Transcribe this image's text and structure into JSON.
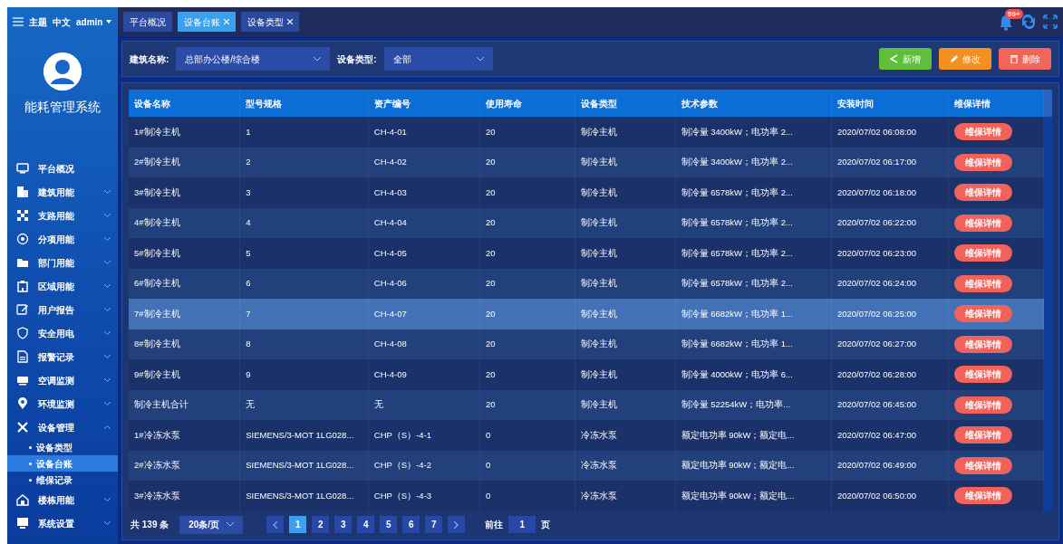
{
  "topbar": {
    "theme": "主题",
    "language": "中文",
    "user": "admin"
  },
  "tabs": [
    {
      "label": "平台概况",
      "closable": false,
      "selected": false
    },
    {
      "label": "设备台账",
      "closable": true,
      "selected": true
    },
    {
      "label": "设备类型",
      "closable": true,
      "selected": false
    }
  ],
  "notifications": {
    "badge": "99+"
  },
  "app_title": "能耗管理系统",
  "sidebar": {
    "items": [
      {
        "label": "平台概况",
        "kind": "link"
      },
      {
        "label": "建筑用能",
        "kind": "group",
        "expanded": false
      },
      {
        "label": "支路用能",
        "kind": "group",
        "expanded": false
      },
      {
        "label": "分项用能",
        "kind": "group",
        "expanded": false
      },
      {
        "label": "部门用能",
        "kind": "group",
        "expanded": false
      },
      {
        "label": "区域用能",
        "kind": "group",
        "expanded": false
      },
      {
        "label": "用户报告",
        "kind": "group",
        "expanded": false
      },
      {
        "label": "安全用电",
        "kind": "group",
        "expanded": false
      },
      {
        "label": "报警记录",
        "kind": "group",
        "expanded": false
      },
      {
        "label": "空调监测",
        "kind": "group",
        "expanded": false
      },
      {
        "label": "环境监测",
        "kind": "group",
        "expanded": false
      },
      {
        "label": "设备管理",
        "kind": "group",
        "expanded": true,
        "children": [
          {
            "label": "设备类型",
            "selected": false
          },
          {
            "label": "设备台账",
            "selected": true
          },
          {
            "label": "维保记录",
            "selected": false
          }
        ]
      },
      {
        "label": "楼栋用能",
        "kind": "group",
        "expanded": false
      },
      {
        "label": "系统设置",
        "kind": "group",
        "expanded": false
      }
    ]
  },
  "filters": [
    {
      "label": "建筑名称:",
      "value": "总部办公楼/综合楼"
    },
    {
      "label": "设备类型:",
      "value": "全部"
    }
  ],
  "actions": [
    {
      "label": "新增",
      "kind": "add"
    },
    {
      "label": "修改",
      "kind": "edit"
    },
    {
      "label": "删除",
      "kind": "delete"
    }
  ],
  "table": {
    "columns": [
      "设备名称",
      "型号规格",
      "资产编号",
      "使用寿命",
      "设备类型",
      "技术参数",
      "安装时间",
      "维保详情"
    ],
    "rows": [
      {
        "cells": [
          "1#制冷主机",
          "1",
          "CH-4-01",
          "20",
          "制冷主机",
          "制冷量 3400kW；电功率 2...",
          "2020/07/02 06:08:00"
        ],
        "action": "维保详情",
        "selected": false
      },
      {
        "cells": [
          "2#制冷主机",
          "2",
          "CH-4-02",
          "20",
          "制冷主机",
          "制冷量 3400kW；电功率 2...",
          "2020/07/02 06:17:00"
        ],
        "action": "维保详情",
        "selected": false
      },
      {
        "cells": [
          "3#制冷主机",
          "3",
          "CH-4-03",
          "20",
          "制冷主机",
          "制冷量 6578kW；电功率 2...",
          "2020/07/02 06:18:00"
        ],
        "action": "维保详情",
        "selected": false
      },
      {
        "cells": [
          "4#制冷主机",
          "4",
          "CH-4-04",
          "20",
          "制冷主机",
          "制冷量 6578kW；电功率 2...",
          "2020/07/02 06:22:00"
        ],
        "action": "维保详情",
        "selected": false
      },
      {
        "cells": [
          "5#制冷主机",
          "5",
          "CH-4-05",
          "20",
          "制冷主机",
          "制冷量 6578kW；电功率 2...",
          "2020/07/02 06:23:00"
        ],
        "action": "维保详情",
        "selected": false
      },
      {
        "cells": [
          "6#制冷主机",
          "6",
          "CH-4-06",
          "20",
          "制冷主机",
          "制冷量 6578kW；电功率 2...",
          "2020/07/02 06:24:00"
        ],
        "action": "维保详情",
        "selected": false
      },
      {
        "cells": [
          "7#制冷主机",
          "7",
          "CH-4-07",
          "20",
          "制冷主机",
          "制冷量 6682kW；电功率 1...",
          "2020/07/02 06:25:00"
        ],
        "action": "维保详情",
        "selected": true
      },
      {
        "cells": [
          "8#制冷主机",
          "8",
          "CH-4-08",
          "20",
          "制冷主机",
          "制冷量 6682kW；电功率 1...",
          "2020/07/02 06:27:00"
        ],
        "action": "维保详情",
        "selected": false
      },
      {
        "cells": [
          "9#制冷主机",
          "9",
          "CH-4-09",
          "20",
          "制冷主机",
          "制冷量 4000kW；电功率 6...",
          "2020/07/02 06:28:00"
        ],
        "action": "维保详情",
        "selected": false
      },
      {
        "cells": [
          "制冷主机合计",
          "无",
          "无",
          "20",
          "制冷主机",
          "制冷量 52254kW；电功率...",
          "2020/07/02 06:45:00"
        ],
        "action": "维保详情",
        "selected": false
      },
      {
        "cells": [
          "1#冷冻水泵",
          "SIEMENS/3-MOT 1LG028...",
          "CHP（S）-4-1",
          "0",
          "冷冻水泵",
          "额定电功率 90kW；额定电...",
          "2020/07/02 06:47:00"
        ],
        "action": "维保详情",
        "selected": false
      },
      {
        "cells": [
          "2#冷冻水泵",
          "SIEMENS/3-MOT 1LG028...",
          "CHP（S）-4-2",
          "0",
          "冷冻水泵",
          "额定电功率 90kW；额定电...",
          "2020/07/02 06:49:00"
        ],
        "action": "维保详情",
        "selected": false
      },
      {
        "cells": [
          "3#冷冻水泵",
          "SIEMENS/3-MOT 1LG028...",
          "CHP（S）-4-3",
          "0",
          "冷冻水泵",
          "额定电功率 90kW；额定电...",
          "2020/07/02 06:50:00"
        ],
        "action": "维保详情",
        "selected": false
      }
    ]
  },
  "pagination": {
    "total": "共 139 条",
    "page_size": "20条/页",
    "pages": [
      {
        "label": "1",
        "selected": true
      },
      {
        "label": "2",
        "selected": false
      },
      {
        "label": "3",
        "selected": false
      },
      {
        "label": "4",
        "selected": false
      },
      {
        "label": "5",
        "selected": false
      },
      {
        "label": "6",
        "selected": false
      },
      {
        "label": "7",
        "selected": false
      }
    ],
    "goto_label": "前往",
    "goto_value": "1",
    "goto_suffix": "页"
  }
}
